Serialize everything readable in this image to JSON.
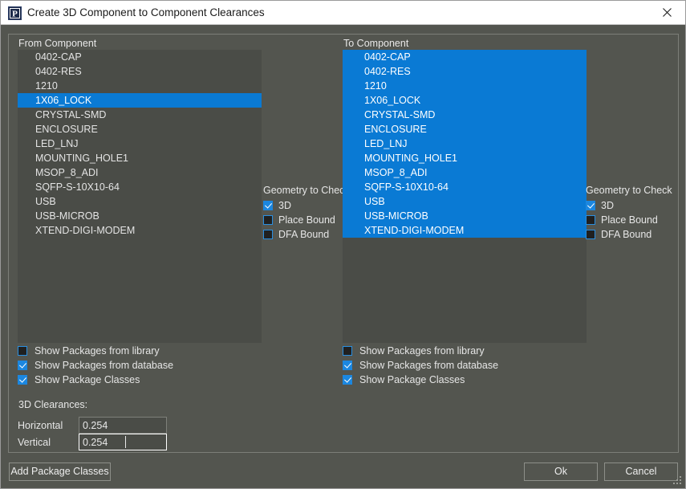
{
  "window": {
    "title": "Create 3D Component to Component Clearances",
    "app_icon": "allegro-p-icon",
    "close_icon": "close-icon"
  },
  "from_panel": {
    "label": "From Component",
    "items": [
      {
        "label": "0402-CAP",
        "selected": false
      },
      {
        "label": "0402-RES",
        "selected": false
      },
      {
        "label": "1210",
        "selected": false
      },
      {
        "label": "1X06_LOCK",
        "selected": true
      },
      {
        "label": "CRYSTAL-SMD",
        "selected": false
      },
      {
        "label": "ENCLOSURE",
        "selected": false
      },
      {
        "label": "LED_LNJ",
        "selected": false
      },
      {
        "label": "MOUNTING_HOLE1",
        "selected": false
      },
      {
        "label": "MSOP_8_ADI",
        "selected": false
      },
      {
        "label": "SQFP-S-10X10-64",
        "selected": false
      },
      {
        "label": "USB",
        "selected": false
      },
      {
        "label": "USB-MICROB",
        "selected": false
      },
      {
        "label": "XTEND-DIGI-MODEM",
        "selected": false
      }
    ],
    "geometry": {
      "title": "Geometry to Check",
      "options": [
        {
          "label": "3D",
          "checked": true
        },
        {
          "label": "Place Bound",
          "checked": false
        },
        {
          "label": "DFA Bound",
          "checked": false
        }
      ]
    },
    "show_options": [
      {
        "label": "Show Packages from library",
        "checked": false
      },
      {
        "label": "Show Packages from database",
        "checked": true
      },
      {
        "label": "Show Package Classes",
        "checked": true
      }
    ]
  },
  "to_panel": {
    "label": "To Component",
    "items": [
      {
        "label": "0402-CAP",
        "selected": true
      },
      {
        "label": "0402-RES",
        "selected": true
      },
      {
        "label": "1210",
        "selected": true
      },
      {
        "label": "1X06_LOCK",
        "selected": true
      },
      {
        "label": "CRYSTAL-SMD",
        "selected": true
      },
      {
        "label": "ENCLOSURE",
        "selected": true
      },
      {
        "label": "LED_LNJ",
        "selected": true
      },
      {
        "label": "MOUNTING_HOLE1",
        "selected": true
      },
      {
        "label": "MSOP_8_ADI",
        "selected": true
      },
      {
        "label": "SQFP-S-10X10-64",
        "selected": true
      },
      {
        "label": "USB",
        "selected": true
      },
      {
        "label": "USB-MICROB",
        "selected": true
      },
      {
        "label": "XTEND-DIGI-MODEM",
        "selected": true
      }
    ],
    "geometry": {
      "title": "Geometry to Check",
      "options": [
        {
          "label": "3D",
          "checked": true
        },
        {
          "label": "Place Bound",
          "checked": false
        },
        {
          "label": "DFA Bound",
          "checked": false
        }
      ]
    },
    "show_options": [
      {
        "label": "Show Packages from library",
        "checked": false
      },
      {
        "label": "Show Packages from database",
        "checked": true
      },
      {
        "label": "Show Package Classes",
        "checked": true
      }
    ]
  },
  "clearances": {
    "title": "3D Clearances:",
    "horizontal": {
      "label": "Horizontal",
      "value": "0.254"
    },
    "vertical": {
      "label": "Vertical",
      "value": "0.254"
    }
  },
  "buttons": {
    "add_package_classes": "Add Package Classes",
    "ok": "Ok",
    "cancel": "Cancel"
  },
  "colors": {
    "accent": "#0a7ad4",
    "dialog_bg": "#53554f",
    "list_bg": "#4a4c47",
    "text": "#e6e6e6"
  }
}
